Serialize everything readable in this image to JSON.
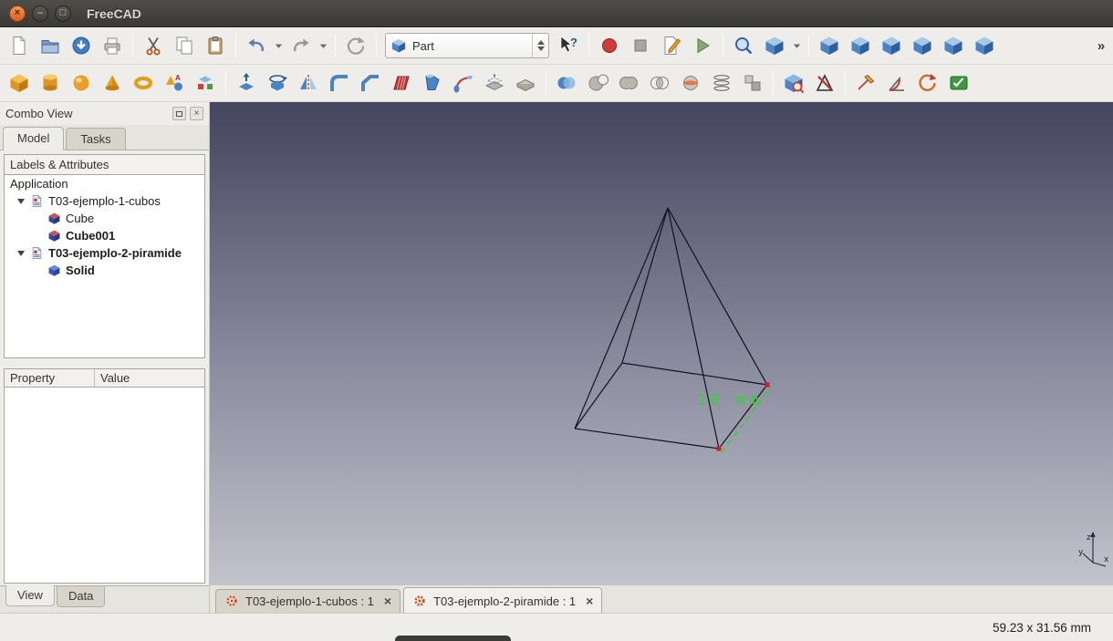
{
  "window": {
    "title": "FreeCAD"
  },
  "workbench_selector": {
    "value": "Part"
  },
  "colors": {
    "viewport_top": "#44455e",
    "viewport_mid": "#8b8c9f",
    "viewport_bottom": "#c3c3cd",
    "dimension_green": "#2fd42f",
    "vertex_red": "#cc2020"
  },
  "toolbars": {
    "standard_left": [
      {
        "name": "new-document-button",
        "shape": "page"
      },
      {
        "name": "open-document-button",
        "shape": "folder"
      },
      {
        "name": "save-button",
        "shape": "disk"
      },
      {
        "name": "print-button",
        "shape": "printer"
      },
      {
        "sep": true
      },
      {
        "name": "cut-button",
        "shape": "scissors"
      },
      {
        "name": "copy-button",
        "shape": "copy"
      },
      {
        "name": "paste-button",
        "shape": "clipboard"
      },
      {
        "sep": true
      },
      {
        "name": "undo-button",
        "shape": "undo"
      },
      {
        "name": "undo-history-dropdown",
        "shape": "chevron"
      },
      {
        "name": "redo-button",
        "shape": "redo"
      },
      {
        "name": "redo-history-dropdown",
        "shape": "chevron"
      },
      {
        "sep": true
      },
      {
        "name": "refresh-button",
        "shape": "refresh"
      },
      {
        "sep": true
      }
    ],
    "standard_right": [
      {
        "name": "whats-this-button",
        "shape": "help-cursor"
      },
      {
        "sep": true
      },
      {
        "name": "macro-record-button",
        "shape": "record"
      },
      {
        "name": "macro-stop-button",
        "shape": "stop"
      },
      {
        "name": "macro-edit-button",
        "shape": "page-edit"
      },
      {
        "name": "macro-execute-button",
        "shape": "play"
      },
      {
        "sep": true
      },
      {
        "name": "fit-all-button",
        "shape": "magnifier"
      },
      {
        "name": "axonometric-view-button",
        "shape": "cube-blue"
      },
      {
        "name": "axonometric-dropdown",
        "shape": "chevron"
      },
      {
        "sep": true
      },
      {
        "name": "view-isometric-button",
        "shape": "cube-blue"
      },
      {
        "name": "view-front-button",
        "shape": "cube-blue"
      },
      {
        "name": "view-top-button",
        "shape": "cube-blue"
      },
      {
        "name": "view-right-button",
        "shape": "cube-blue"
      },
      {
        "name": "view-rear-button",
        "shape": "cube-blue"
      },
      {
        "name": "view-bottom-button",
        "shape": "cube-blue"
      },
      {
        "name": "toolbar-extend-button",
        "shape": "overflow",
        "push": true
      }
    ],
    "part": [
      {
        "name": "part-box-button",
        "shape": "p-box"
      },
      {
        "name": "part-cylinder-button",
        "shape": "p-cylinder"
      },
      {
        "name": "part-sphere-button",
        "shape": "p-sphere"
      },
      {
        "name": "part-cone-button",
        "shape": "p-cone"
      },
      {
        "name": "part-torus-button",
        "shape": "p-torus"
      },
      {
        "name": "part-primitives-button",
        "shape": "p-primitives"
      },
      {
        "name": "part-shape-builder-button",
        "shape": "p-shapebuilder"
      },
      {
        "sep": true
      },
      {
        "name": "part-extrude-button",
        "shape": "p-extrude"
      },
      {
        "name": "part-revolve-button",
        "shape": "p-revolve"
      },
      {
        "name": "part-mirror-button",
        "shape": "p-mirror"
      },
      {
        "name": "part-fillet-button",
        "shape": "p-fillet"
      },
      {
        "name": "part-chamfer-button",
        "shape": "p-chamfer"
      },
      {
        "name": "part-ruled-surface-button",
        "shape": "p-ruled"
      },
      {
        "name": "part-loft-button",
        "shape": "p-loft"
      },
      {
        "name": "part-sweep-button",
        "shape": "p-sweep"
      },
      {
        "name": "part-offset-button",
        "shape": "p-offset"
      },
      {
        "name": "part-thickness-button",
        "shape": "p-thickness"
      },
      {
        "sep": true
      },
      {
        "name": "part-boolean-button",
        "shape": "p-boolean"
      },
      {
        "name": "part-cut-button",
        "shape": "p-cut"
      },
      {
        "name": "part-union-button",
        "shape": "p-union"
      },
      {
        "name": "part-common-button",
        "shape": "p-common"
      },
      {
        "name": "part-section-button",
        "shape": "p-section"
      },
      {
        "name": "part-cross-sections-button",
        "shape": "p-crosssections"
      },
      {
        "name": "part-compound-button",
        "shape": "p-compound"
      },
      {
        "sep": true
      },
      {
        "name": "part-check-geometry-button",
        "shape": "p-check"
      },
      {
        "name": "part-defeaturing-button",
        "shape": "p-defeature"
      },
      {
        "sep": true
      },
      {
        "name": "part-measure-linear-button",
        "shape": "p-measure-linear"
      },
      {
        "name": "part-measure-angular-button",
        "shape": "p-measure-angular"
      },
      {
        "name": "part-measure-refresh-button",
        "shape": "p-measure-refresh"
      },
      {
        "name": "part-measure-toggle-button",
        "shape": "p-measure-toggle"
      }
    ]
  },
  "combo_view": {
    "title": "Combo View",
    "tabs": [
      {
        "label": "Model",
        "active": true
      },
      {
        "label": "Tasks",
        "active": false
      }
    ],
    "labels_header": "Labels & Attributes",
    "tree": [
      {
        "label": "Application",
        "level": 0,
        "bold": false
      },
      {
        "label": "T03-ejemplo-1-cubos",
        "level": 1,
        "icon": "doc",
        "bold": false,
        "expanded": true
      },
      {
        "label": "Cube",
        "level": 2,
        "icon": "cube-red",
        "bold": false
      },
      {
        "label": "Cube001",
        "level": 2,
        "icon": "cube-red",
        "bold": true
      },
      {
        "label": "T03-ejemplo-2-piramide",
        "level": 1,
        "icon": "doc",
        "bold": true,
        "expanded": true
      },
      {
        "label": "Solid",
        "level": 2,
        "icon": "cube-blue",
        "bold": true
      }
    ],
    "property_columns": [
      "Property",
      "Value"
    ],
    "bottom_tabs": [
      {
        "label": "View",
        "active": true
      },
      {
        "label": "Data",
        "active": false
      }
    ]
  },
  "viewport": {
    "dimension_label": "10 mm",
    "axes": [
      "z",
      "y",
      "x"
    ]
  },
  "document_tabs": [
    {
      "label": "T03-ejemplo-1-cubos : 1",
      "active": false
    },
    {
      "label": "T03-ejemplo-2-piramide : 1",
      "active": true
    }
  ],
  "status_bar": {
    "dimensions": "59.23 x 31.56 mm"
  }
}
